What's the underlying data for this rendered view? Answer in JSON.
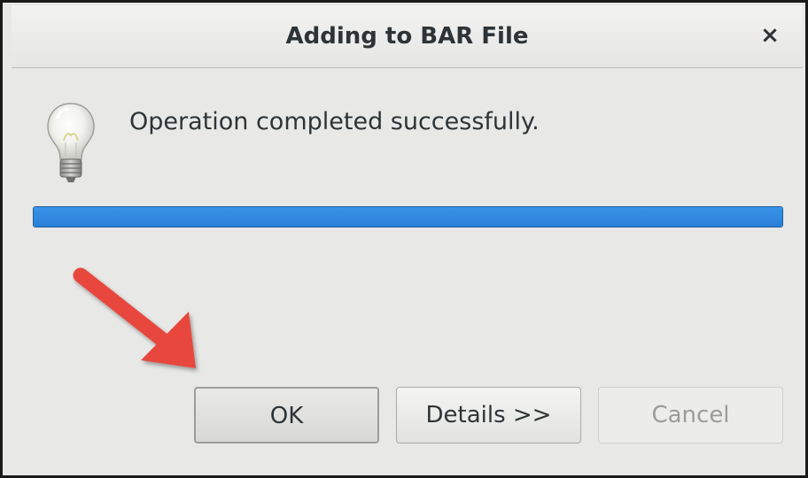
{
  "dialog": {
    "title": "Adding to BAR File",
    "close_glyph": "×",
    "message": "Operation completed successfully.",
    "progress_fraction": 1.0,
    "icon": "lightbulb-icon"
  },
  "buttons": {
    "ok_label": "OK",
    "details_label": "Details >>",
    "cancel_label": "Cancel"
  },
  "annotation": {
    "arrow_color": "#e8473c"
  },
  "colors": {
    "accent": "#2a80d7",
    "title_text": "#2e3436",
    "disabled_text": "#9a9c9c"
  }
}
